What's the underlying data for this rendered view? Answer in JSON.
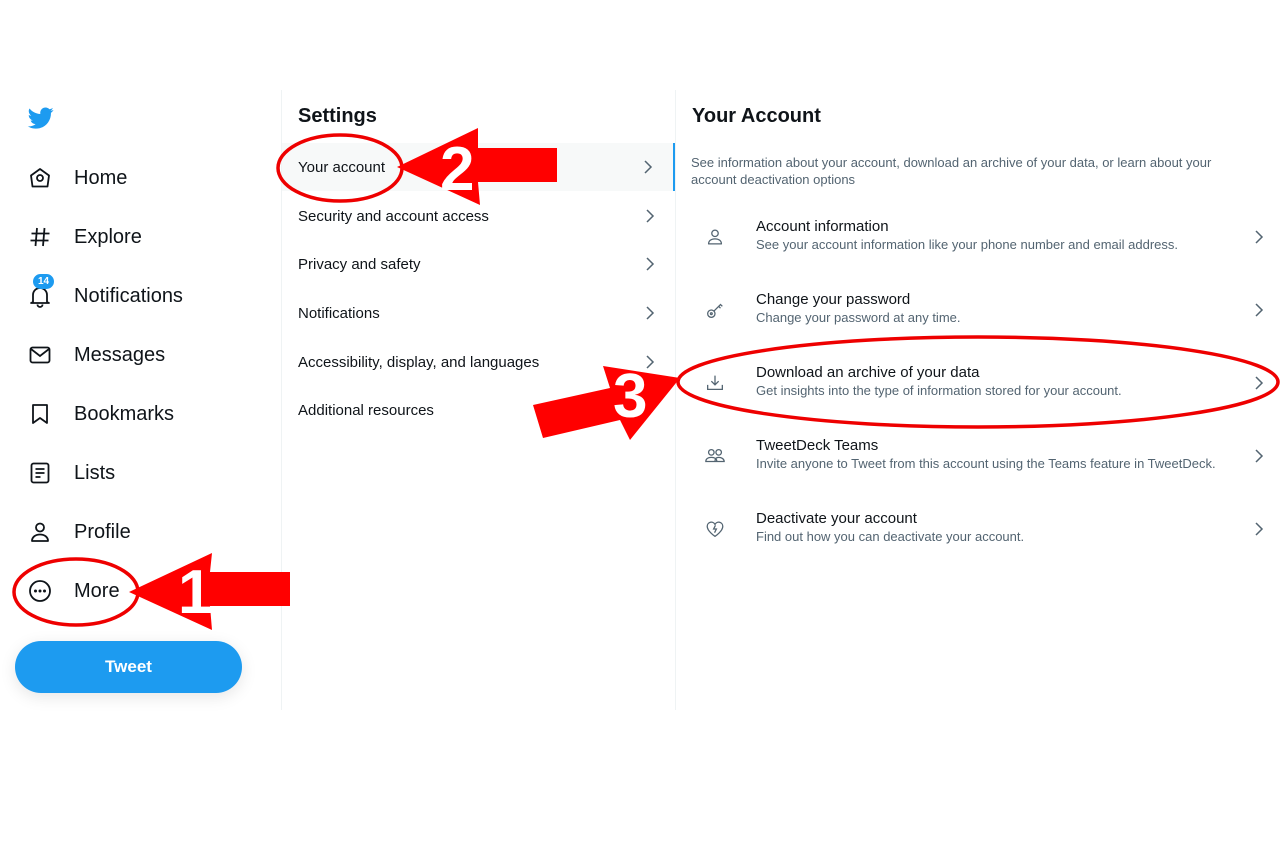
{
  "nav": {
    "logo_icon": "twitter-bird-icon",
    "items": [
      {
        "label": "Home",
        "icon": "home-icon"
      },
      {
        "label": "Explore",
        "icon": "hashtag-icon"
      },
      {
        "label": "Notifications",
        "icon": "bell-icon",
        "badge": "14"
      },
      {
        "label": "Messages",
        "icon": "envelope-icon"
      },
      {
        "label": "Bookmarks",
        "icon": "bookmark-icon"
      },
      {
        "label": "Lists",
        "icon": "list-icon"
      },
      {
        "label": "Profile",
        "icon": "person-icon"
      },
      {
        "label": "More",
        "icon": "more-circle-icon"
      }
    ],
    "tweet_button": "Tweet"
  },
  "settings": {
    "title": "Settings",
    "items": [
      {
        "label": "Your account",
        "active": true
      },
      {
        "label": "Security and account access"
      },
      {
        "label": "Privacy and safety"
      },
      {
        "label": "Notifications"
      },
      {
        "label": "Accessibility, display, and languages"
      },
      {
        "label": "Additional resources"
      }
    ]
  },
  "account": {
    "title": "Your Account",
    "description": "See information about your account, download an archive of your data, or learn about your account deactivation options",
    "items": [
      {
        "title": "Account information",
        "subtitle": "See your account information like your phone number and email address.",
        "icon": "person-icon"
      },
      {
        "title": "Change your password",
        "subtitle": "Change your password at any time.",
        "icon": "key-icon"
      },
      {
        "title": "Download an archive of your data",
        "subtitle": "Get insights into the type of information stored for your account.",
        "icon": "download-icon"
      },
      {
        "title": "TweetDeck Teams",
        "subtitle": "Invite anyone to Tweet from this account using the Teams feature in TweetDeck.",
        "icon": "people-icon"
      },
      {
        "title": "Deactivate your account",
        "subtitle": "Find out how you can deactivate your account.",
        "icon": "broken-heart-icon"
      }
    ]
  },
  "annotations": {
    "step1": "1",
    "step2": "2",
    "step3": "3",
    "color": "#ff0000"
  },
  "colors": {
    "accent": "#1d9bf0",
    "text_primary": "#0f1419",
    "text_secondary": "#536471"
  }
}
